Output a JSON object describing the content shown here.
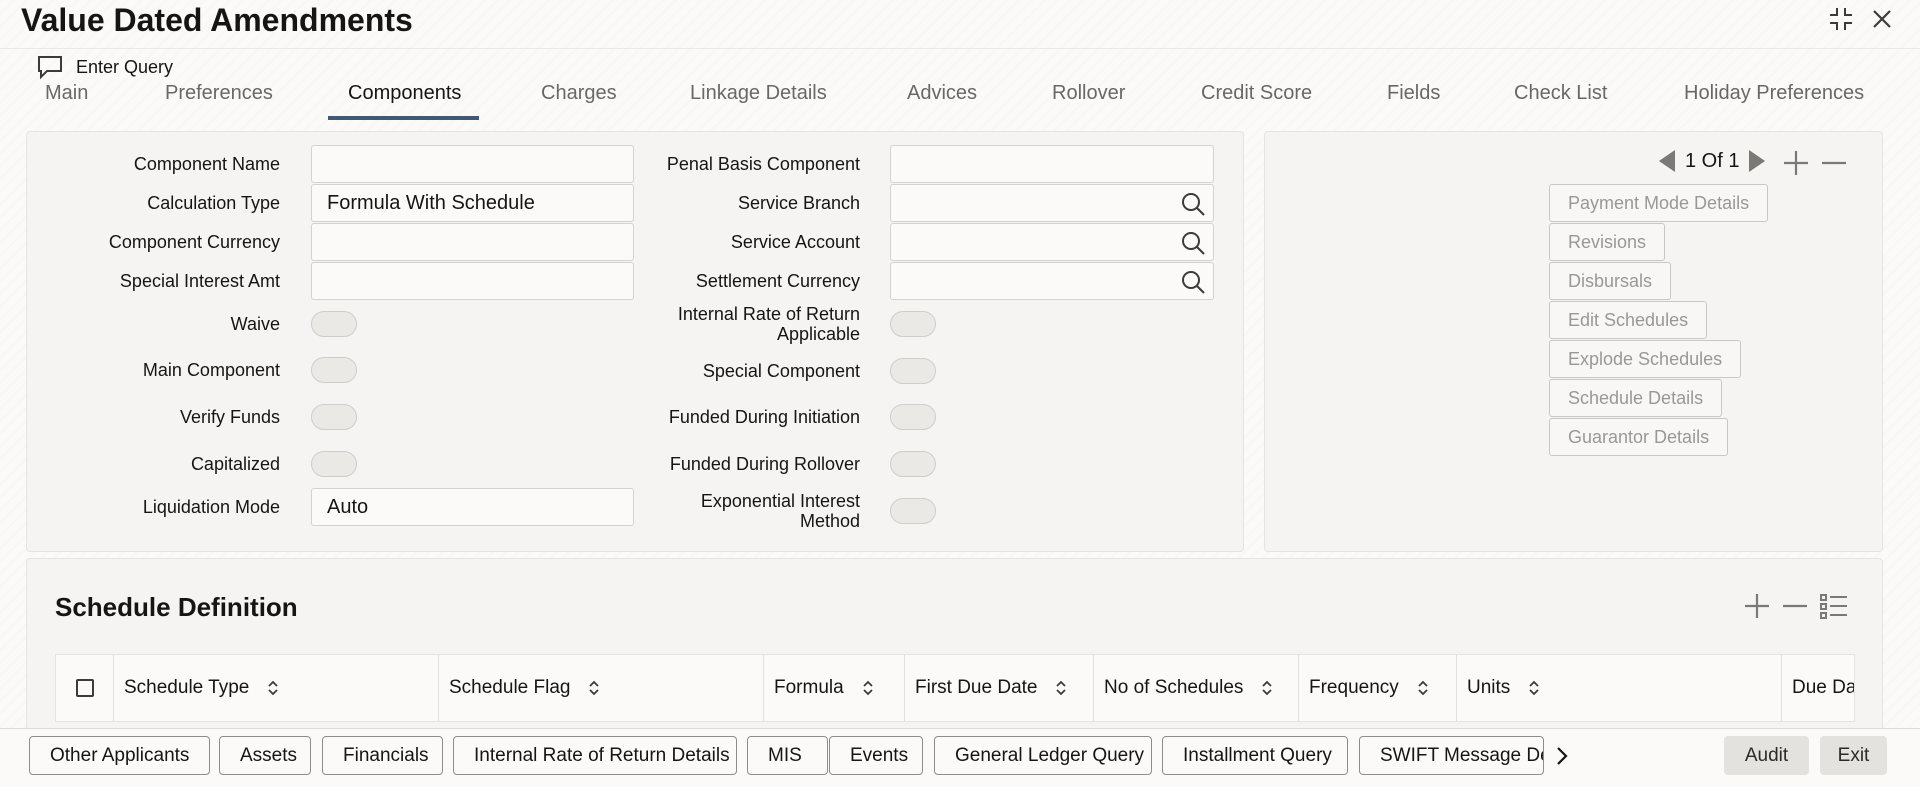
{
  "window": {
    "title": "Value Dated Amendments"
  },
  "toolbar": {
    "enter_query": "Enter Query"
  },
  "tabs": [
    {
      "label": "Main"
    },
    {
      "label": "Preferences"
    },
    {
      "label": "Components"
    },
    {
      "label": "Charges"
    },
    {
      "label": "Linkage Details"
    },
    {
      "label": "Advices"
    },
    {
      "label": "Rollover"
    },
    {
      "label": "Credit Score"
    },
    {
      "label": "Fields"
    },
    {
      "label": "Check List"
    },
    {
      "label": "Holiday Preferences"
    }
  ],
  "active_tab": "Components",
  "form": {
    "component_name": {
      "label": "Component Name",
      "value": ""
    },
    "calculation_type": {
      "label": "Calculation Type",
      "value": "Formula With Schedule"
    },
    "component_currency": {
      "label": "Component Currency",
      "value": ""
    },
    "special_interest_amt": {
      "label": "Special Interest Amt",
      "value": ""
    },
    "waive": {
      "label": "Waive"
    },
    "main_component": {
      "label": "Main Component"
    },
    "verify_funds": {
      "label": "Verify Funds"
    },
    "capitalized": {
      "label": "Capitalized"
    },
    "liquidation_mode": {
      "label": "Liquidation Mode",
      "value": "Auto"
    },
    "penal_basis_component": {
      "label": "Penal Basis Component",
      "value": ""
    },
    "service_branch": {
      "label": "Service Branch",
      "value": ""
    },
    "service_account": {
      "label": "Service Account",
      "value": ""
    },
    "settlement_currency": {
      "label": "Settlement Currency",
      "value": ""
    },
    "irr_applicable": {
      "label_line1": "Internal Rate of Return",
      "label_line2": "Applicable"
    },
    "special_component": {
      "label": "Special Component"
    },
    "funded_during_initiation": {
      "label": "Funded During Initiation"
    },
    "funded_during_rollover": {
      "label": "Funded During Rollover"
    },
    "exponential_interest": {
      "label_line1": "Exponential Interest",
      "label_line2": "Method"
    }
  },
  "pager": {
    "text": "1 Of 1"
  },
  "side_buttons": [
    {
      "label": "Payment Mode Details"
    },
    {
      "label": "Revisions"
    },
    {
      "label": "Disbursals"
    },
    {
      "label": "Edit Schedules"
    },
    {
      "label": "Explode Schedules"
    },
    {
      "label": "Schedule Details"
    },
    {
      "label": "Guarantor Details"
    }
  ],
  "schedule": {
    "title": "Schedule Definition",
    "columns": [
      {
        "label": "Schedule Type"
      },
      {
        "label": "Schedule Flag"
      },
      {
        "label": "Formula"
      },
      {
        "label": "First Due Date"
      },
      {
        "label": "No of Schedules"
      },
      {
        "label": "Frequency"
      },
      {
        "label": "Units"
      },
      {
        "label": "Due Da"
      }
    ]
  },
  "footer": {
    "buttons": [
      {
        "label": "Other Applicants"
      },
      {
        "label": "Assets"
      },
      {
        "label": "Financials"
      },
      {
        "label": "Internal Rate of Return Details"
      },
      {
        "label": "MIS"
      },
      {
        "label": "Events"
      },
      {
        "label": "General Ledger Query"
      },
      {
        "label": "Installment Query"
      },
      {
        "label": "SWIFT Message Det"
      }
    ],
    "audit": "Audit",
    "exit": "Exit"
  }
}
